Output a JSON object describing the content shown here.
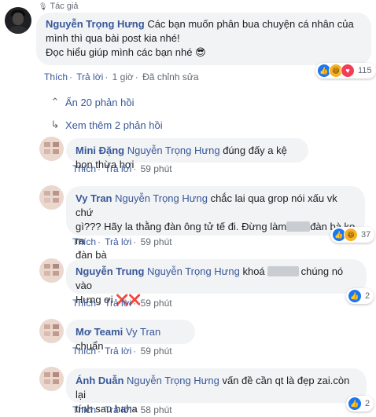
{
  "post": {
    "author_badge": "Tác giả",
    "author": "Nguyễn Trọng Hưng",
    "text_line1": "Các bạn muốn phân bua chuyện cá nhân của",
    "text_line2": "mình thì qua bài post kia nhé!",
    "text_line3": "Đọc hiểu giúp mình các bạn nhé 😎",
    "actions": {
      "like": "Thích",
      "reply": "Trả lời",
      "time": "1 giờ",
      "edited": "Đã chỉnh sửa"
    },
    "reaction_count": "115"
  },
  "hide_replies": "Ẩn 20 phản hồi",
  "more_replies": "Xem thêm 2 phản hồi",
  "action_labels": {
    "like": "Thích",
    "reply": "Trả lời"
  },
  "replies": [
    {
      "name": "Mini Đặng",
      "tag": "Nguyễn Trọng Hưng",
      "text": "đúng đấy a kệ bọn thừa hơi",
      "time": "59 phút"
    },
    {
      "name": "Vy Tran",
      "tag": "Nguyễn Trọng Hưng",
      "text1": "chắc lai qua grop nói xấu vk chứ",
      "text2": "gì??? Hãy la thằng đàn ông tử tế đi. Đừng làm",
      "text3": "đàn bà ko ra",
      "text4": "đàn bà",
      "time": "59 phút",
      "reaction_count": "37"
    },
    {
      "name": "Nguyễn Trung",
      "tag": "Nguyễn Trọng Hưng",
      "text1": "khoá",
      "text2": "chúng nó vào",
      "text3": "Hưng ơi",
      "emoji": "❌❌",
      "time": "59 phút",
      "reaction_count": "2"
    },
    {
      "name": "Mơ Teami",
      "tag": "Vy Tran",
      "text": "chuẩn",
      "time": "59 phút"
    },
    {
      "name": "Ánh Duẫn",
      "tag": "Nguyễn Trọng Hưng",
      "text1": "vấn đề cần qt là đẹp zai.còn lại",
      "text2": "tính sau haha",
      "time": "58 phút",
      "reaction_count": "2"
    }
  ],
  "colors": {
    "link": "#385898",
    "meta": "#606770",
    "bubble": "#f2f3f5",
    "like": "#1877f2",
    "haha": "#f7b125"
  }
}
